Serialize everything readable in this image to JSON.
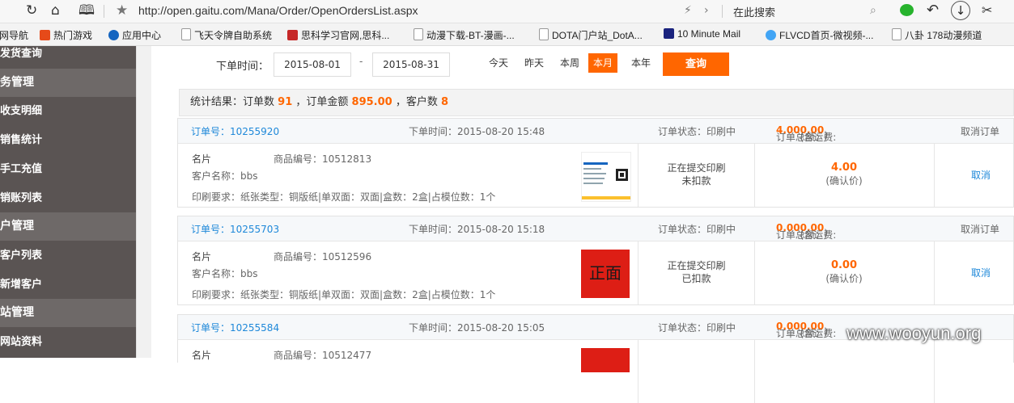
{
  "browser": {
    "url": "http://open.gaitu.com/Mana/Order/OpenOrdersList.aspx",
    "search_placeholder": "在此搜索",
    "bookmarks": [
      "网导航",
      "热门游戏",
      "应用中心",
      "飞天令牌自助系统",
      "思科学习官网,思科...",
      "动漫下载-BT-漫画-...",
      "DOTA门户站_DotA...",
      "10 Minute Mail",
      "FLVCD首页-微视频-...",
      "八卦 178动漫频道"
    ]
  },
  "sidebar": {
    "items": [
      {
        "label": "发货查询",
        "type": "item"
      },
      {
        "label": "务管理",
        "type": "header"
      },
      {
        "label": "收支明细",
        "type": "item"
      },
      {
        "label": "销售统计",
        "type": "item"
      },
      {
        "label": "手工充值",
        "type": "item"
      },
      {
        "label": "销账列表",
        "type": "item"
      },
      {
        "label": "户管理",
        "type": "header"
      },
      {
        "label": "客户列表",
        "type": "item"
      },
      {
        "label": "新增客户",
        "type": "item"
      },
      {
        "label": "站管理",
        "type": "header"
      },
      {
        "label": "网站资料",
        "type": "item"
      }
    ]
  },
  "filter": {
    "label": "下单时间：",
    "start_date": "2015-08-01",
    "dash": "-",
    "end_date": "2015-08-31",
    "quick": [
      "今天",
      "昨天",
      "本周",
      "本月",
      "本年"
    ],
    "active": "本月",
    "query_button": "查询"
  },
  "stats": {
    "prefix": "统计结果：订单数",
    "order_count": "91",
    "amount_label": "，订单金额",
    "amount": "895.00",
    "customer_label": "，客户数",
    "customer_count": "8"
  },
  "orders": [
    {
      "order_no": "订单号：10255920",
      "time": "下单时间：2015-08-20 15:48",
      "status_head": "订单状态：印刷中",
      "total_label": "订单总额：",
      "total": "4.00",
      "shipping_label": "(含运费:",
      "shipping": "0.00",
      "shipping_end": ")",
      "cancel_head": "取消订单",
      "product": "名片",
      "product_code": "商品编号：10512813",
      "customer": "客户名称：bbs",
      "requirement": "印刷要求：纸张类型：铜版纸|单双面：双面|盒数：2盒|占模位数：1个",
      "status_line1": "正在提交印刷",
      "status_line2": "未扣款",
      "amount": "4.00",
      "amount_note": "(确认价)",
      "cancel": "取消",
      "thumb": "card"
    },
    {
      "order_no": "订单号：10255703",
      "time": "下单时间：2015-08-20 15:18",
      "status_head": "订单状态：印刷中",
      "total_label": "订单总额：",
      "total": "0.00",
      "shipping_label": "(含运费:",
      "shipping": "0.00",
      "shipping_end": ")",
      "cancel_head": "取消订单",
      "product": "名片",
      "product_code": "商品编号：10512596",
      "customer": "客户名称：bbs",
      "requirement": "印刷要求：纸张类型：铜版纸|单双面：双面|盒数：2盒|占模位数：1个",
      "status_line1": "正在提交印刷",
      "status_line2": "已扣款",
      "amount": "0.00",
      "amount_note": "(确认价)",
      "cancel": "取消",
      "thumb": "red",
      "thumb_text": "正面"
    },
    {
      "order_no": "订单号：10255584",
      "time": "下单时间：2015-08-20 15:05",
      "status_head": "订单状态：印刷中",
      "total_label": "订单总额：",
      "total": "0.00",
      "shipping_label": "(含运费:",
      "shipping": "0.00",
      "shipping_end": ")",
      "cancel_head": "取消订单",
      "product": "名片",
      "product_code": "商品编号：10512477"
    }
  ],
  "watermark": "www.wooyun.org",
  "colors": {
    "accent": "#ff6600",
    "link": "#1e88d9",
    "sidebar": "#5a5453"
  }
}
